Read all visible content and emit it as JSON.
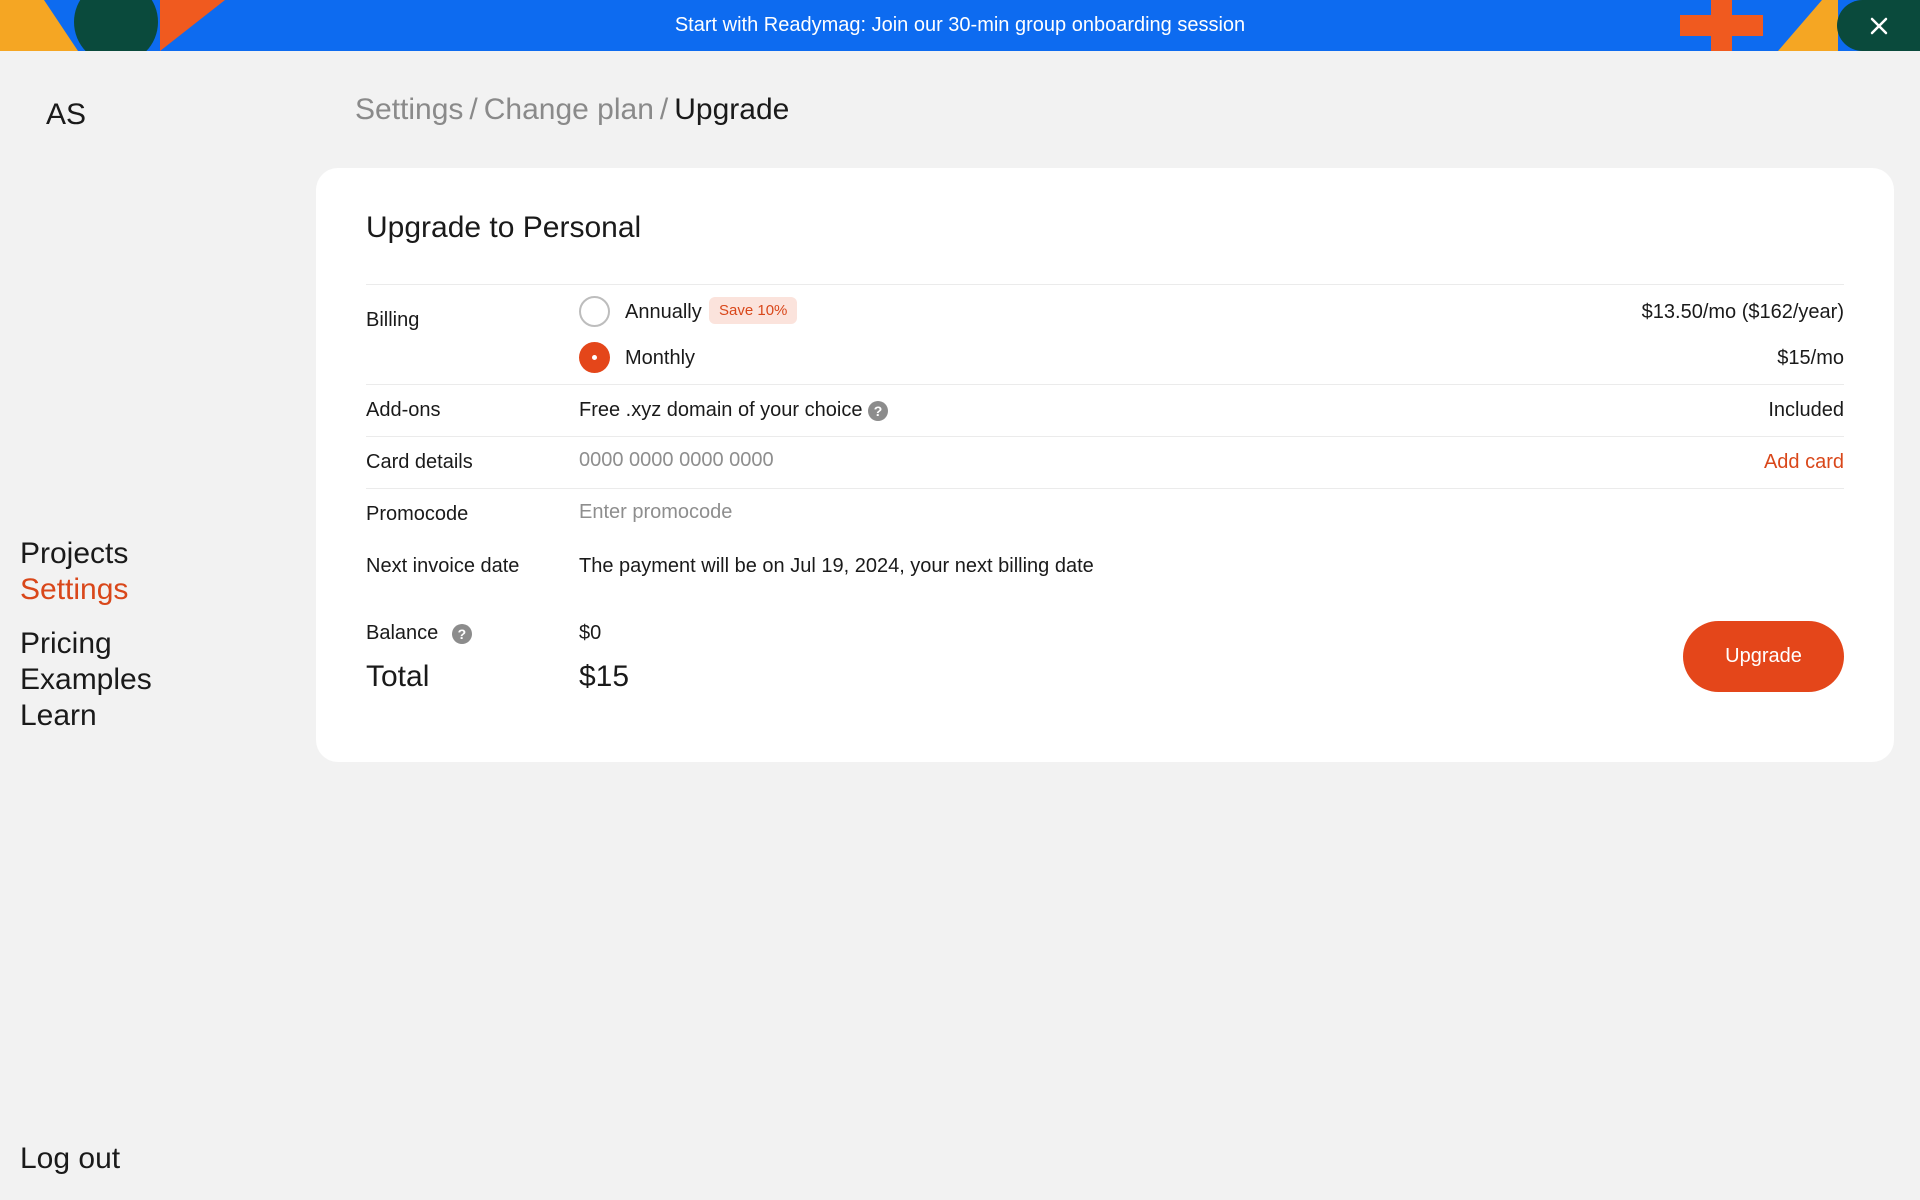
{
  "banner": {
    "text": "Start with Readymag: Join our 30-min group onboarding session",
    "colors": {
      "background": "#0d6bf0",
      "accent_orange": "#f05a1f",
      "accent_yellow": "#f5a623",
      "accent_green": "#0a4a3c"
    },
    "close_icon": "close-icon"
  },
  "sidebar": {
    "avatar": "AS",
    "nav": [
      {
        "label": "Projects",
        "active": false
      },
      {
        "label": "Settings",
        "active": true
      },
      {
        "label": "Pricing",
        "active": false
      },
      {
        "label": "Examples",
        "active": false
      },
      {
        "label": "Learn",
        "active": false
      }
    ],
    "logout": "Log out"
  },
  "breadcrumb": {
    "items": [
      "Settings",
      "Change plan",
      "Upgrade"
    ],
    "separator": "/"
  },
  "card": {
    "title": "Upgrade to Personal",
    "billing": {
      "label": "Billing",
      "options": [
        {
          "label": "Annually",
          "badge": "Save 10%",
          "price": "$13.50/mo ($162/year)",
          "selected": false
        },
        {
          "label": "Monthly",
          "price": "$15/mo",
          "selected": true
        }
      ]
    },
    "addons": {
      "label": "Add-ons",
      "value": "Free .xyz domain of your choice",
      "status": "Included"
    },
    "card_details": {
      "label": "Card details",
      "placeholder": "0000 0000 0000 0000",
      "action": "Add card"
    },
    "promocode": {
      "label": "Promocode",
      "placeholder": "Enter promocode"
    },
    "next_invoice": {
      "label": "Next invoice date",
      "value": "The payment will be on Jul 19, 2024, your next billing date"
    },
    "balance": {
      "label": "Balance",
      "value": "$0"
    },
    "total": {
      "label": "Total",
      "value": "$15"
    },
    "upgrade_button": "Upgrade"
  },
  "colors": {
    "accent": "#e4461a",
    "page_background": "#f2f2f2"
  }
}
